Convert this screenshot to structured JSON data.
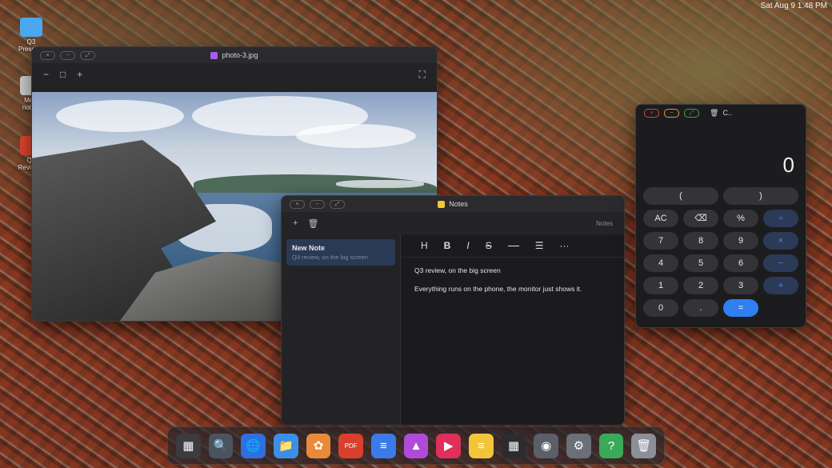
{
  "status": {
    "time_text": "Sat Aug 9  1:48 PM"
  },
  "desktop": {
    "items": [
      {
        "label": "Q3\nPresen...",
        "icon": "folder-icon",
        "color": "#4aa8f0"
      },
      {
        "label": "Meet\nnote...",
        "icon": "text-file-icon",
        "color": "#cfcfcf"
      },
      {
        "label": "Q3\nReview...",
        "icon": "pdf-file-icon",
        "color": "#e0452f"
      }
    ]
  },
  "photo_window": {
    "title": "photo-3.jpg",
    "toolbar": {
      "zoom_out": "−",
      "fit": "□",
      "zoom_in": "+",
      "fullscreen": "⛶"
    }
  },
  "notes_window": {
    "title": "Notes",
    "toolbar_label": "Notes",
    "new_icon": "+",
    "trash_icon": "🗑",
    "notes": [
      {
        "title": "New Note",
        "snippet": "Q3 review, on the big screen"
      }
    ],
    "format_bar": {
      "heading": "H",
      "bold": "B",
      "italic": "I",
      "strike": "S",
      "more": "···"
    },
    "content": {
      "line1": "Q3 review, on the big screen",
      "line2": "Everything runs on the phone, the monitor just shows it."
    }
  },
  "calculator_window": {
    "title": "C..",
    "display": "0",
    "keys": [
      "(",
      ")",
      "AC",
      "⌫",
      "%",
      "÷",
      "7",
      "8",
      "9",
      "×",
      "4",
      "5",
      "6",
      "−",
      "1",
      "2",
      "3",
      "+",
      "0",
      ".",
      "="
    ]
  },
  "dock": {
    "apps": [
      {
        "name": "launcher",
        "icon": "grid-icon",
        "glyph": "▦",
        "color": "#3b3b40"
      },
      {
        "name": "search",
        "icon": "search-icon",
        "glyph": "🔍",
        "color": "#4a5360"
      },
      {
        "name": "browser",
        "icon": "globe-icon",
        "glyph": "🌐",
        "color": "#2f6fe0"
      },
      {
        "name": "files",
        "icon": "folder-icon",
        "glyph": "📁",
        "color": "#3b8fe8"
      },
      {
        "name": "photos",
        "icon": "photos-icon",
        "glyph": "✿",
        "color": "#e88a3a"
      },
      {
        "name": "pdf",
        "icon": "pdf-icon",
        "glyph": "PDF",
        "color": "#d8402e"
      },
      {
        "name": "docs",
        "icon": "document-icon",
        "glyph": "≡",
        "color": "#3a7be8"
      },
      {
        "name": "gallery",
        "icon": "image-icon",
        "glyph": "▲",
        "color": "#b04ad8"
      },
      {
        "name": "video",
        "icon": "play-icon",
        "glyph": "▶",
        "color": "#e0305a"
      },
      {
        "name": "notes",
        "icon": "notes-icon",
        "glyph": "≡",
        "color": "#f2c43a"
      },
      {
        "name": "calculator",
        "icon": "calculator-icon",
        "glyph": "▦",
        "color": "#2c2c30"
      },
      {
        "name": "camera",
        "icon": "camera-icon",
        "glyph": "◉",
        "color": "#5a5f68"
      },
      {
        "name": "settings",
        "icon": "gear-icon",
        "glyph": "⚙",
        "color": "#6a6f78"
      },
      {
        "name": "help",
        "icon": "help-icon",
        "glyph": "?",
        "color": "#3aaa5a"
      },
      {
        "name": "trash",
        "icon": "trash-icon",
        "glyph": "🗑",
        "color": "#8a8f98"
      }
    ]
  }
}
